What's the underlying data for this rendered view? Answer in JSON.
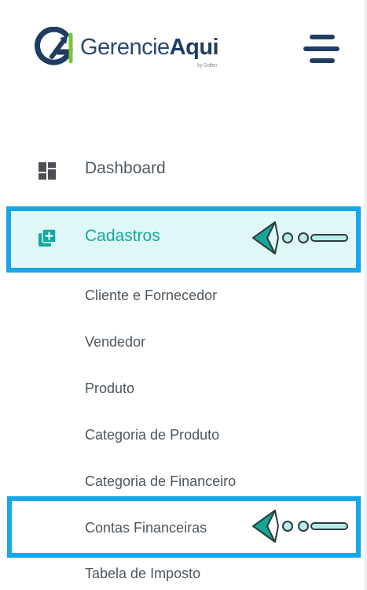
{
  "header": {
    "logo_name": "Gerencie",
    "logo_name_strong": "Aqui",
    "logo_tagline": "by Soften",
    "menu_icon": "hamburger-menu-icon",
    "brand_color": "#1f3d63"
  },
  "sidebar": {
    "items": [
      {
        "label": "Dashboard",
        "icon": "dashboard-grid-icon"
      },
      {
        "label": "Cadastros",
        "icon": "add-box-icon",
        "active": true
      }
    ],
    "submenu": [
      {
        "label": "Cliente e Fornecedor"
      },
      {
        "label": "Vendedor"
      },
      {
        "label": "Produto"
      },
      {
        "label": "Categoria de Produto"
      },
      {
        "label": "Categoria de Financeiro"
      },
      {
        "label": "Contas Financeiras"
      },
      {
        "label": "Tabela de Imposto"
      }
    ]
  },
  "annotations": {
    "pointer_icon": "arrow-pointer-icon",
    "highlight_color": "#17a6e8",
    "active_accent": "#13a89e"
  }
}
